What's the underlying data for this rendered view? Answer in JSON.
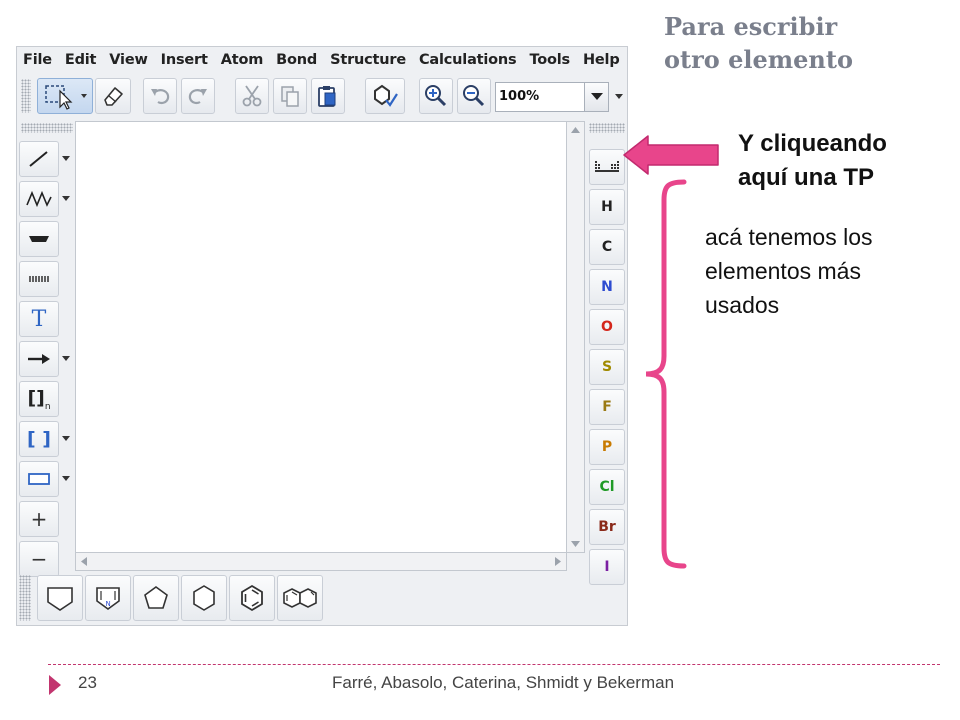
{
  "slide": {
    "title_line1": "Para escribir",
    "title_line2": "otro elemento",
    "callout_1_line1": "Y cliqueando",
    "callout_1_line2": "aquí una TP",
    "callout_2_line1": "acá tenemos los",
    "callout_2_line2": "elementos más",
    "callout_2_line3": "usados",
    "page_number": "23",
    "footer_credit": "Farré, Abasolo, Caterina, Shmidt y Bekerman"
  },
  "menubar": {
    "items": [
      {
        "label": "File"
      },
      {
        "label": "Edit"
      },
      {
        "label": "View"
      },
      {
        "label": "Insert"
      },
      {
        "label": "Atom"
      },
      {
        "label": "Bond"
      },
      {
        "label": "Structure"
      },
      {
        "label": "Calculations"
      },
      {
        "label": "Tools"
      },
      {
        "label": "Help"
      }
    ]
  },
  "toolbar": {
    "zoom_value": "100%",
    "icons": [
      "selection-icon",
      "eraser-icon",
      "undo-icon",
      "redo-icon",
      "cut-icon",
      "copy-icon",
      "paste-icon",
      "clean-structure-icon",
      "zoom-in-icon",
      "zoom-out-icon"
    ]
  },
  "left_tools": {
    "text_tool_label": "T",
    "bracket_tool_label": "[]",
    "bracket_subscript": "n",
    "colored_bracket_label": "[ ]",
    "plus_label": "+",
    "minus_label": "−"
  },
  "elements": {
    "items": [
      {
        "symbol": "H",
        "color": "#222222"
      },
      {
        "symbol": "C",
        "color": "#222222"
      },
      {
        "symbol": "N",
        "color": "#2d4bd0"
      },
      {
        "symbol": "O",
        "color": "#d4261b"
      },
      {
        "symbol": "S",
        "color": "#a08a00"
      },
      {
        "symbol": "F",
        "color": "#9a7a14"
      },
      {
        "symbol": "P",
        "color": "#c87a00"
      },
      {
        "symbol": "Cl",
        "color": "#1f9a26"
      },
      {
        "symbol": "Br",
        "color": "#8a2a1a"
      },
      {
        "symbol": "I",
        "color": "#7b1fa2"
      }
    ]
  },
  "templates": {
    "icons": [
      "pentagon-template-icon",
      "pyrrole-template-icon",
      "cyclopentane-template-icon",
      "cyclohexane-template-icon",
      "benzene-template-icon",
      "naphthalene-template-icon"
    ],
    "pyrrole_atom": "N"
  },
  "colors": {
    "accent_pink": "#e8458b",
    "footer_line": "#c2356f",
    "title_gray": "#7a7f8c"
  }
}
